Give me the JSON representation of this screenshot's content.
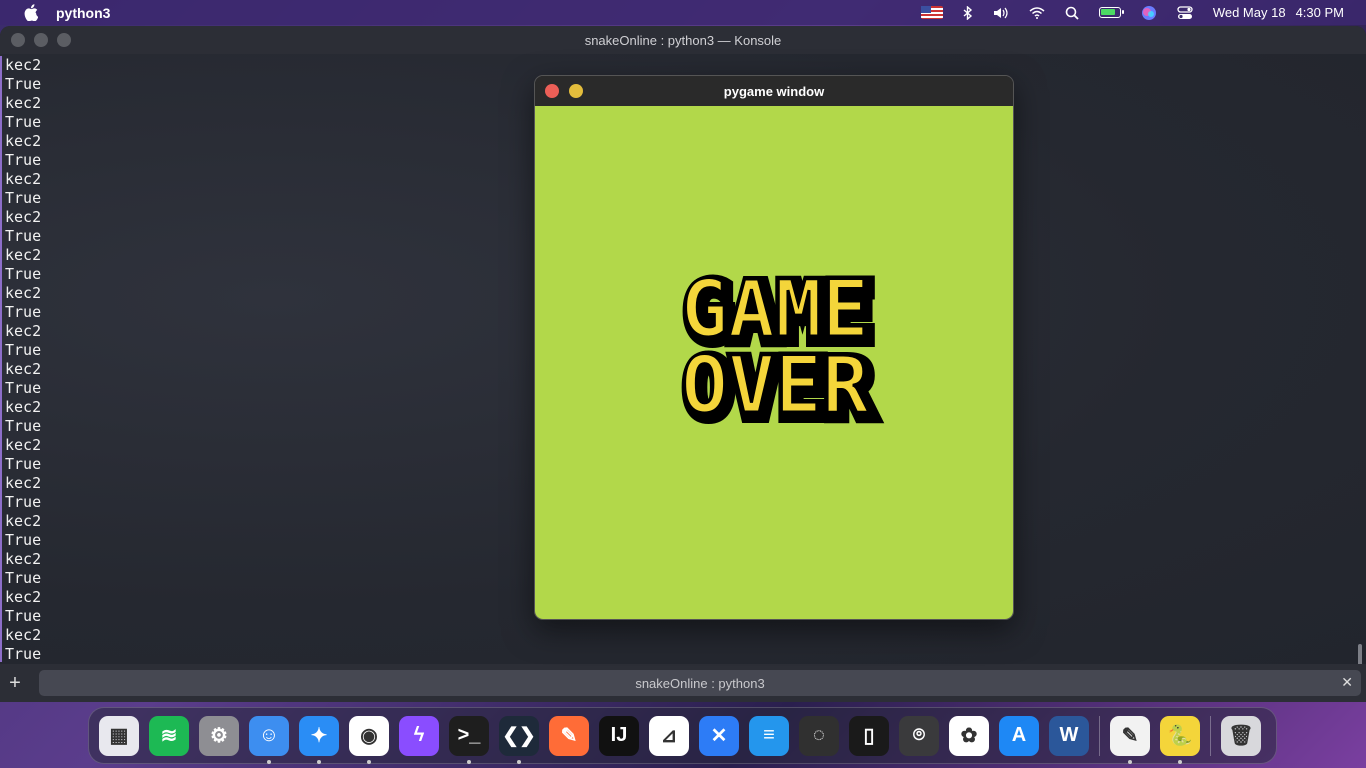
{
  "menubar": {
    "app_name": "python3",
    "date": "Wed May 18",
    "time": "4:30 PM"
  },
  "konsole": {
    "title": "snakeOnline : python3 — Konsole",
    "lines": [
      "kec2",
      "True",
      "kec2",
      "True",
      "kec2",
      "True",
      "kec2",
      "True",
      "kec2",
      "True",
      "kec2",
      "True",
      "kec2",
      "True",
      "kec2",
      "True",
      "kec2",
      "True",
      "kec2",
      "True",
      "kec2",
      "True",
      "kec2",
      "True",
      "kec2",
      "True",
      "kec2",
      "True",
      "kec2",
      "True",
      "kec2",
      "True",
      "kec2"
    ],
    "tab_label": "snakeOnline : python3",
    "new_tab_glyph": "+",
    "close_tab_glyph": "✕"
  },
  "pygame": {
    "title": "pygame window",
    "text_line1": "GAME",
    "text_line2": "OVER",
    "background": "#b2d84a",
    "text_color": "#f4d53a"
  },
  "dock": {
    "apps": [
      {
        "name": "launchpad-icon",
        "color": "#e8e8ee",
        "glyph": "▦"
      },
      {
        "name": "spotify-icon",
        "color": "#1db954",
        "glyph": "≋"
      },
      {
        "name": "system-preferences-icon",
        "color": "#8e8e93",
        "glyph": "⚙"
      },
      {
        "name": "finder-icon",
        "color": "#3d8ef0",
        "glyph": "☺"
      },
      {
        "name": "safari-icon",
        "color": "#2a8df5",
        "glyph": "✦"
      },
      {
        "name": "chrome-icon",
        "color": "#ffffff",
        "glyph": "◉"
      },
      {
        "name": "messenger-icon",
        "color": "#8a4dff",
        "glyph": "ϟ"
      },
      {
        "name": "terminal-icon",
        "color": "#1e1e1e",
        "glyph": ">_"
      },
      {
        "name": "vscode-icon",
        "color": "#1e2a3a",
        "glyph": "❮❯"
      },
      {
        "name": "postman-icon",
        "color": "#ff6c37",
        "glyph": "✎"
      },
      {
        "name": "intellij-icon",
        "color": "#111111",
        "glyph": "IJ"
      },
      {
        "name": "instruments-icon",
        "color": "#ffffff",
        "glyph": "⊿"
      },
      {
        "name": "xcode-icon",
        "color": "#2d7cf6",
        "glyph": "✕"
      },
      {
        "name": "docker-icon",
        "color": "#2496ed",
        "glyph": "≡"
      },
      {
        "name": "obs-icon",
        "color": "#303030",
        "glyph": "◌"
      },
      {
        "name": "iphone-simulator-icon",
        "color": "#1a1a1a",
        "glyph": "▯"
      },
      {
        "name": "screenshot-icon",
        "color": "#3a3a3c",
        "glyph": "⌾"
      },
      {
        "name": "photos-icon",
        "color": "#ffffff",
        "glyph": "✿"
      },
      {
        "name": "app-store-icon",
        "color": "#1e88f5",
        "glyph": "A"
      },
      {
        "name": "word-icon",
        "color": "#2b579a",
        "glyph": "W"
      },
      {
        "name": "textedit-icon",
        "color": "#f2f2f2",
        "glyph": "✎"
      },
      {
        "name": "python-launcher-icon",
        "color": "#f4d53a",
        "glyph": "🐍"
      },
      {
        "name": "trash-icon",
        "color": "#d8d8dc",
        "glyph": "🗑"
      }
    ]
  }
}
